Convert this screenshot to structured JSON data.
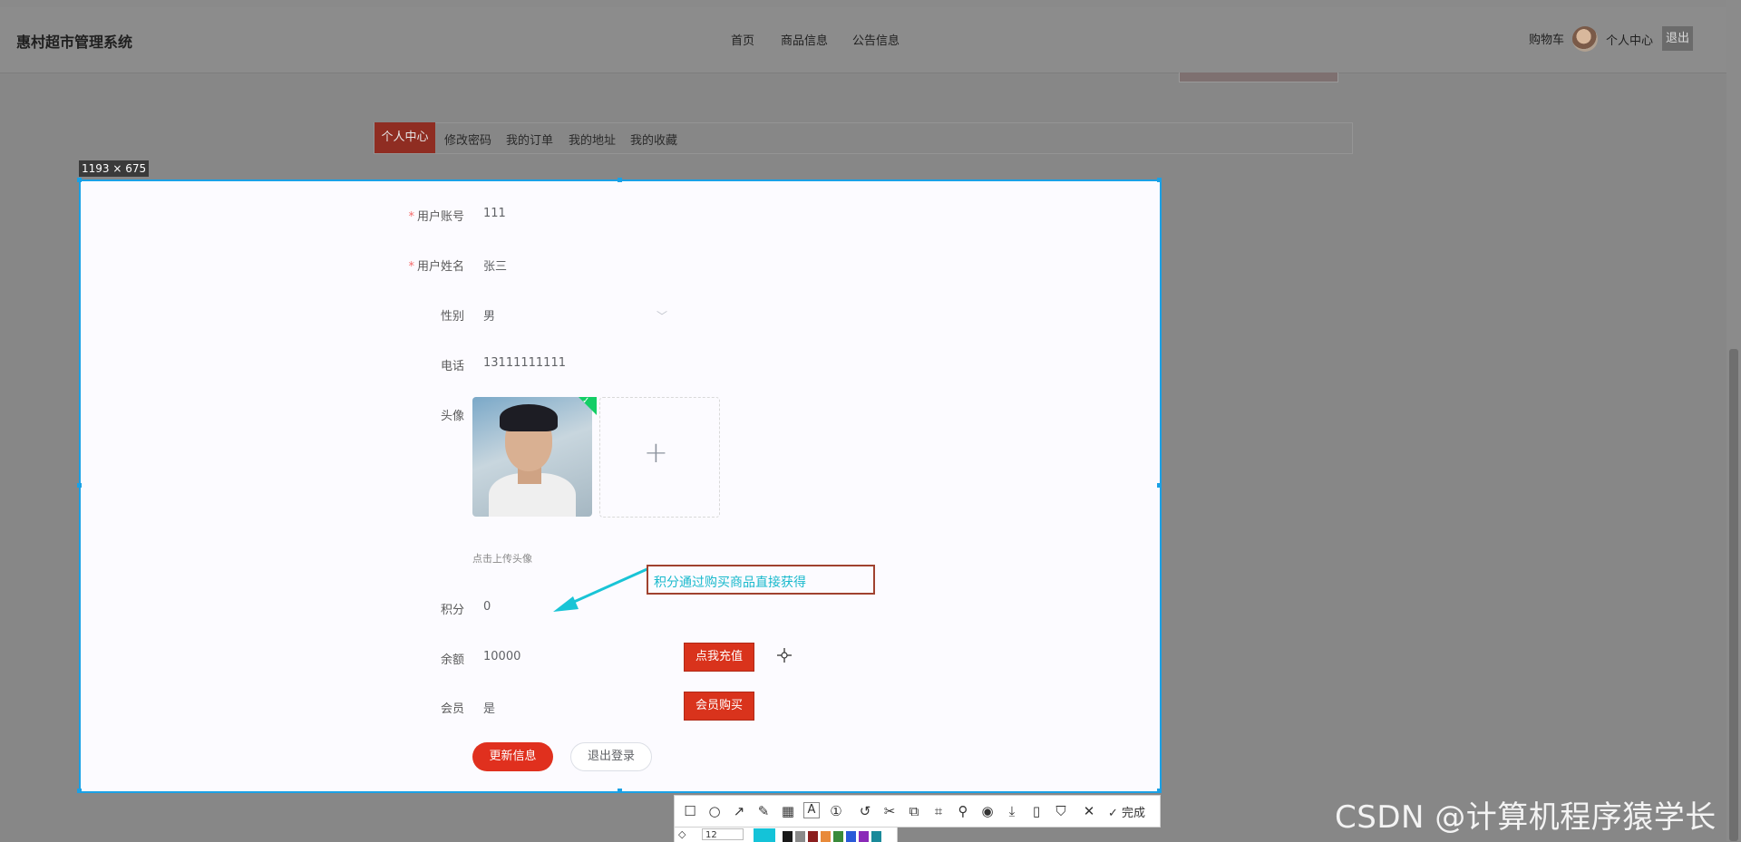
{
  "header": {
    "title": "惠村超市管理系统",
    "nav": [
      "首页",
      "商品信息",
      "公告信息"
    ],
    "cart_label": "购物车",
    "personal_center_label": "个人中心",
    "logout_label": "退出"
  },
  "tabs": {
    "active": "个人中心",
    "items": [
      "修改密码",
      "我的订单",
      "我的地址",
      "我的收藏"
    ]
  },
  "capture": {
    "size_label": "1193 × 675"
  },
  "form": {
    "account": {
      "label": "用户账号",
      "value": "111"
    },
    "name": {
      "label": "用户姓名",
      "value": "张三"
    },
    "gender": {
      "label": "性别",
      "value": "男"
    },
    "phone": {
      "label": "电话",
      "value": "13111111111"
    },
    "avatar": {
      "label": "头像",
      "hint": "点击上传头像"
    },
    "points": {
      "label": "积分",
      "value": "0"
    },
    "balance": {
      "label": "余额",
      "value": "10000",
      "action": "点我充值"
    },
    "member": {
      "label": "会员",
      "value": "是",
      "action": "会员购买"
    },
    "update_label": "更新信息",
    "logout_label": "退出登录"
  },
  "annotation": {
    "text": "积分通过购买商品直接获得"
  },
  "toolbar": {
    "done_label": "完成",
    "font_size": "12",
    "tools": [
      "rectangle-icon",
      "ellipse-icon",
      "arrow-icon",
      "pencil-icon",
      "mosaic-icon",
      "text-icon",
      "number-icon",
      "undo-icon",
      "scissor-icon",
      "translate-icon",
      "ocr-icon",
      "pin-icon",
      "record-icon",
      "download-icon",
      "long-screenshot-icon",
      "bookmark-icon",
      "close-icon"
    ],
    "colors": [
      "#14c3d8",
      "#1a1a1a",
      "#8a8a8a",
      "#8b1e1e",
      "#e88a3a",
      "#3a8a3a",
      "#2a5ad8",
      "#8a2ab8",
      "#1a8a9a"
    ]
  },
  "watermark": "CSDN @计算机程序猿学长"
}
